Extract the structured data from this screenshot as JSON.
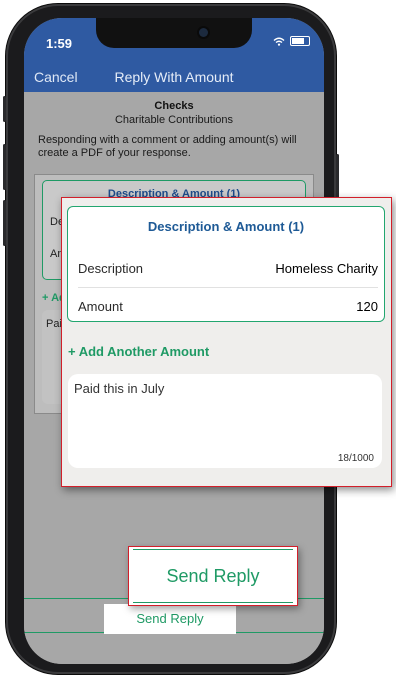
{
  "status_bar": {
    "time": "1:59"
  },
  "navbar": {
    "cancel_label": "Cancel",
    "title": "Reply With Amount"
  },
  "header": {
    "title": "Checks",
    "subtitle": "Charitable Contributions"
  },
  "notice": "Responding with a comment or adding amount(s) will create a PDF of your response.",
  "background_form": {
    "card_title": "Description & Amount (1)",
    "row1_label": "Descri",
    "row2_label": "Am",
    "add_label": "+ Add",
    "comment_label": "Paid"
  },
  "zoom_form": {
    "card_title": "Description & Amount (1)",
    "rows": [
      {
        "label": "Description",
        "value": "Homeless Charity"
      },
      {
        "label": "Amount",
        "value": "120"
      }
    ],
    "add_label": "+ Add Another Amount",
    "comment_text": "Paid this in July",
    "char_count": "18/1000"
  },
  "send_button": {
    "label": "Send Reply"
  },
  "colors": {
    "nav_blue": "#2f5aa2",
    "accent_green": "#1f9a65",
    "callout_red": "#d21f2a"
  }
}
